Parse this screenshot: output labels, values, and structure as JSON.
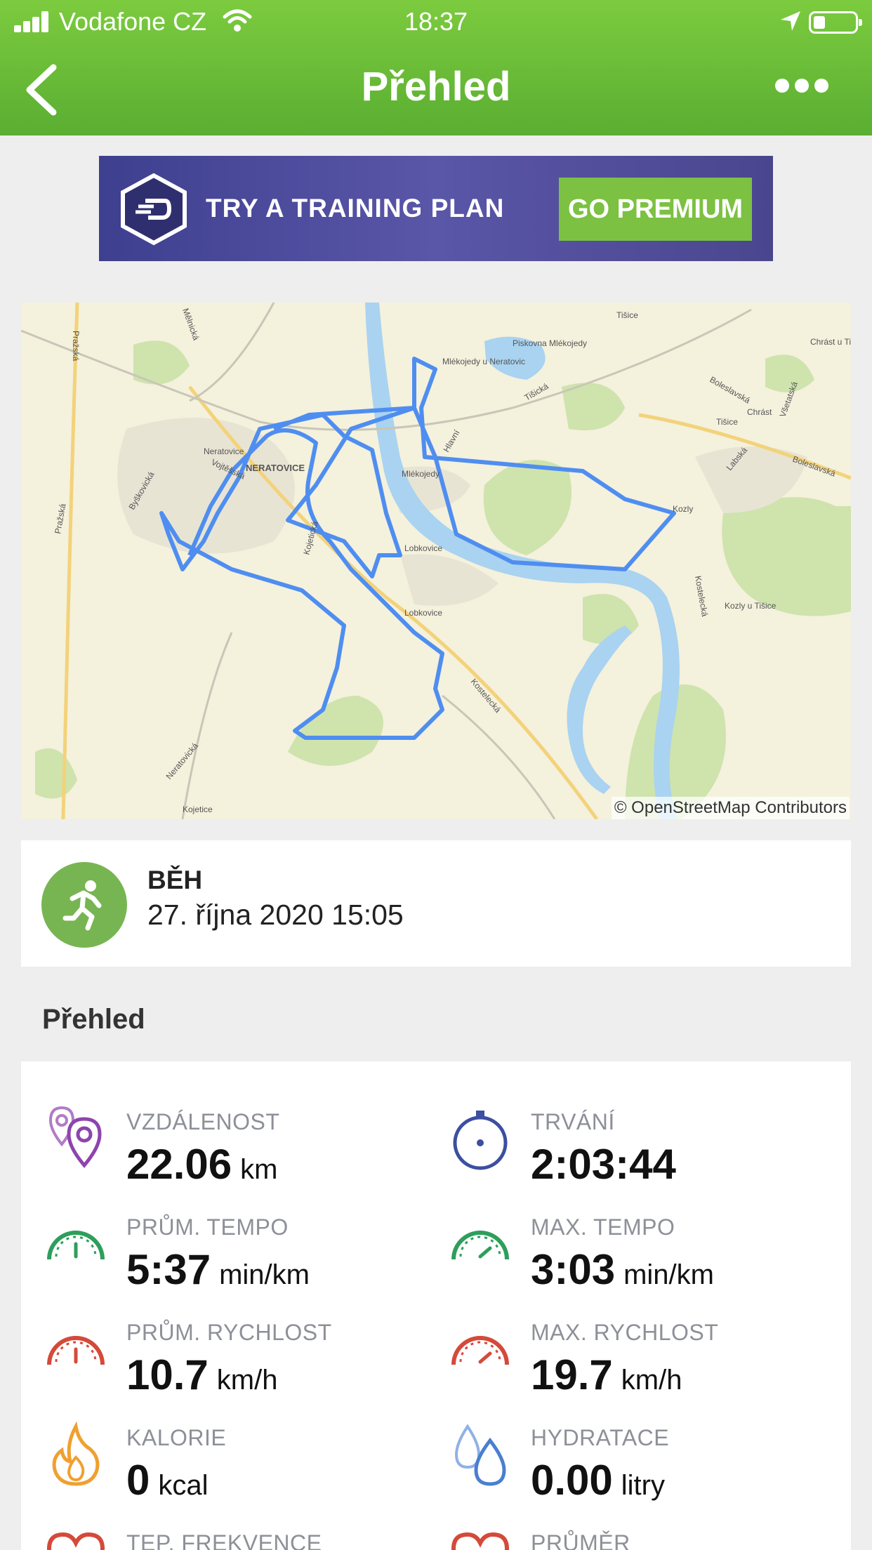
{
  "status_bar": {
    "carrier": "Vodafone CZ",
    "time": "18:37"
  },
  "header": {
    "title": "Přehled"
  },
  "ad": {
    "text": "TRY A TRAINING PLAN",
    "button": "GO PREMIUM"
  },
  "map": {
    "credit": "© OpenStreetMap Contributors",
    "places": [
      "Neratovice",
      "NERATOVICE",
      "Mlékojedy u Neratovic",
      "Mlékojedy",
      "Lobkovice",
      "Lobkovice",
      "Kozly",
      "Kozly u Tišice",
      "Tišice",
      "Tišice",
      "Chrást",
      "Chrást u Tišic",
      "Kojetice",
      "Piskovna Mlékojedy",
      "Pražská",
      "Pražská",
      "Mělnická",
      "Byškovická",
      "Vojtěšská",
      "Kojetická",
      "Kostelecká",
      "Kostelecká",
      "Neratovická",
      "Tišická",
      "Labská",
      "Boleslavská",
      "Boleslavská",
      "Všetatská",
      "Hlavní"
    ]
  },
  "activity": {
    "type": "BĚH",
    "date": "27. října 2020 15:05"
  },
  "section_title": "Přehled",
  "stats": [
    {
      "label": "VZDÁLENOST",
      "value": "22.06",
      "unit": "km",
      "icon": "location-pins-icon",
      "color": "#8e44ad"
    },
    {
      "label": "TRVÁNÍ",
      "value": "2:03:44",
      "unit": "",
      "icon": "stopwatch-icon",
      "color": "#3c4fa0"
    },
    {
      "label": "PRŮM. TEMPO",
      "value": "5:37",
      "unit": "min/km",
      "icon": "speedometer-green-icon",
      "color": "#2e9e5b"
    },
    {
      "label": "MAX. TEMPO",
      "value": "3:03",
      "unit": "min/km",
      "icon": "speedometer-green-icon",
      "color": "#2e9e5b"
    },
    {
      "label": "PRŮM. RYCHLOST",
      "value": "10.7",
      "unit": "km/h",
      "icon": "speedometer-red-icon",
      "color": "#d44a3a"
    },
    {
      "label": "MAX. RYCHLOST",
      "value": "19.7",
      "unit": "km/h",
      "icon": "speedometer-red-icon",
      "color": "#d44a3a"
    },
    {
      "label": "KALORIE",
      "value": "0",
      "unit": "kcal",
      "icon": "flame-icon",
      "color": "#f0a030"
    },
    {
      "label": "HYDRATACE",
      "value": "0.00",
      "unit": "litry",
      "icon": "water-drops-icon",
      "color": "#4a7fd0"
    },
    {
      "label": "TEP. FREKVENCE",
      "value": "",
      "unit": "",
      "icon": "heart-icon",
      "color": "#d44a3a"
    },
    {
      "label": "PRŮMĚR",
      "value": "",
      "unit": "",
      "icon": "heart-icon",
      "color": "#d44a3a"
    }
  ]
}
